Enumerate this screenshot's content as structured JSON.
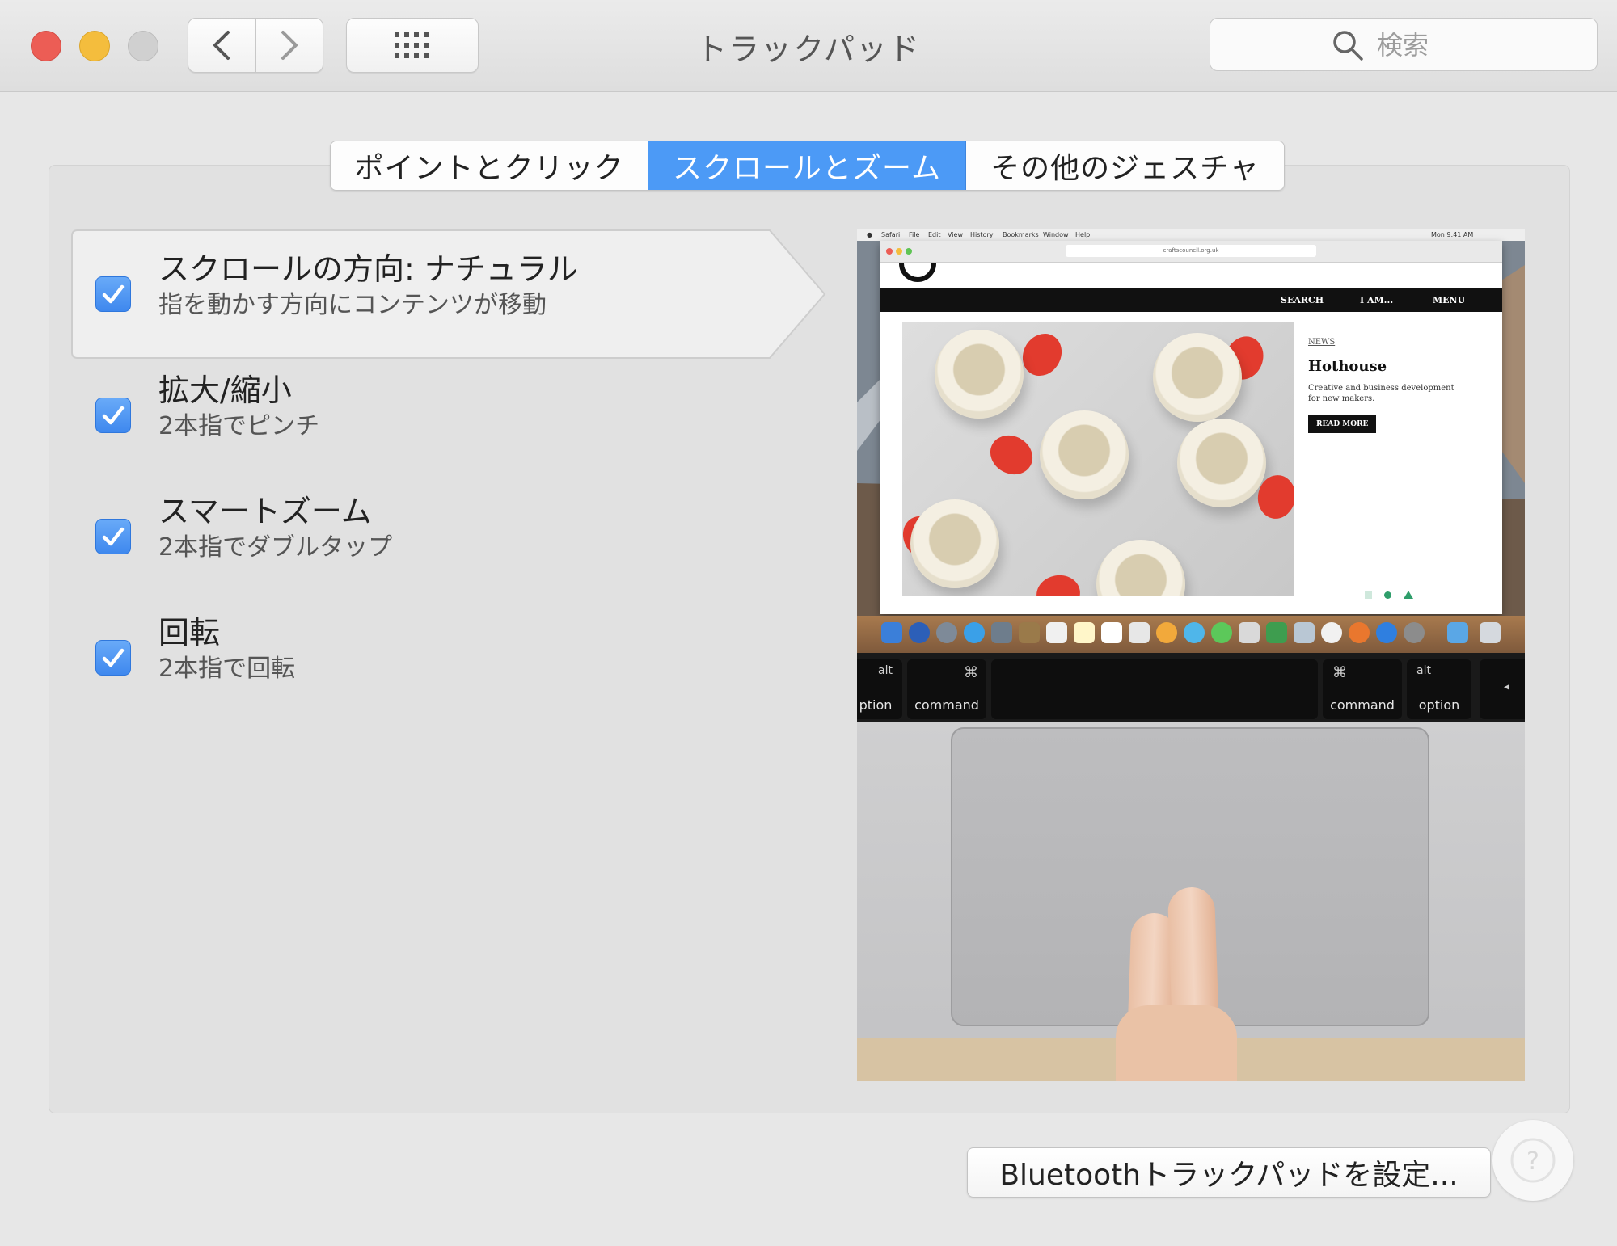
{
  "window": {
    "title": "トラックパッド",
    "search_placeholder": "検索"
  },
  "tabs": [
    {
      "label": "ポイントとクリック",
      "active": false
    },
    {
      "label": "スクロールとズーム",
      "active": true
    },
    {
      "label": "その他のジェスチャ",
      "active": false
    }
  ],
  "options": [
    {
      "title": "スクロールの方向: ナチュラル",
      "subtitle": "指を動かす方向にコンテンツが移動",
      "checked": true
    },
    {
      "title": "拡大/縮小",
      "subtitle": "2本指でピンチ",
      "checked": true
    },
    {
      "title": "スマートズーム",
      "subtitle": "2本指でダブルタップ",
      "checked": true
    },
    {
      "title": "回転",
      "subtitle": "2本指で回転",
      "checked": true
    }
  ],
  "preview": {
    "menubar": [
      "Safari",
      "File",
      "Edit",
      "View",
      "History",
      "Bookmarks",
      "Window",
      "Help"
    ],
    "clock": "Mon 9:41 AM",
    "url": "craftscouncil.org.uk",
    "nav": {
      "search": "SEARCH",
      "iam": "I AM...",
      "menu": "MENU"
    },
    "article": {
      "tag": "NEWS",
      "title": "Hothouse",
      "description": "Creative and business development for new makers.",
      "button": "READ MORE"
    },
    "keys": [
      {
        "symbol": "alt",
        "label": "ption"
      },
      {
        "symbol": "⌘",
        "label": "command"
      },
      {
        "symbol": "⌘",
        "label": "command"
      },
      {
        "symbol": "alt",
        "label": "option"
      }
    ]
  },
  "footer": {
    "bluetooth_button": "Bluetoothトラックパッドを設定..."
  },
  "colors": {
    "accent": "#4c9af6",
    "close": "#ec5d55",
    "minimize": "#f4bd3d"
  }
}
